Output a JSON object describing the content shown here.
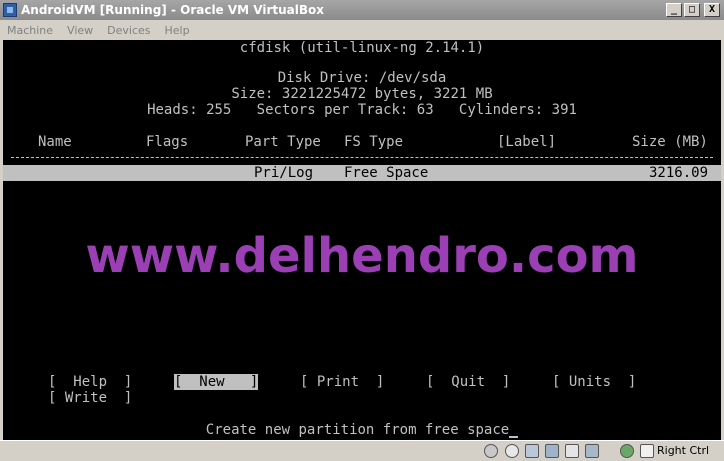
{
  "window": {
    "title": "AndroidVM [Running] - Oracle VM VirtualBox",
    "minimize": "_",
    "maximize": "□",
    "close": "X"
  },
  "menu": [
    "Machine",
    "View",
    "Devices",
    "Help"
  ],
  "terminal": {
    "program": "cfdisk (util-linux-ng 2.14.1)",
    "disk_drive": "Disk Drive: /dev/sda",
    "size": "Size: 3221225472 bytes, 3221 MB",
    "geometry": "Heads: 255   Sectors per Track: 63   Cylinders: 391",
    "columns": {
      "name": "Name",
      "flags": "Flags",
      "part_type": "Part Type",
      "fs_type": "FS Type",
      "label": "[Label]",
      "size": "Size (MB)"
    },
    "row": {
      "part_type": "Pri/Log",
      "fs_type": "Free Space",
      "size": "3216.09"
    },
    "options": {
      "help": "[  Help  ]",
      "new": "[  New   ]",
      "print": "[ Print  ]",
      "quit": "[  Quit  ]",
      "units": "[ Units  ]",
      "write": "[ Write  ]"
    },
    "status": "Create new partition from free space"
  },
  "watermark": "www.delhendro.com",
  "statusbar": {
    "host_key": "Right Ctrl"
  }
}
